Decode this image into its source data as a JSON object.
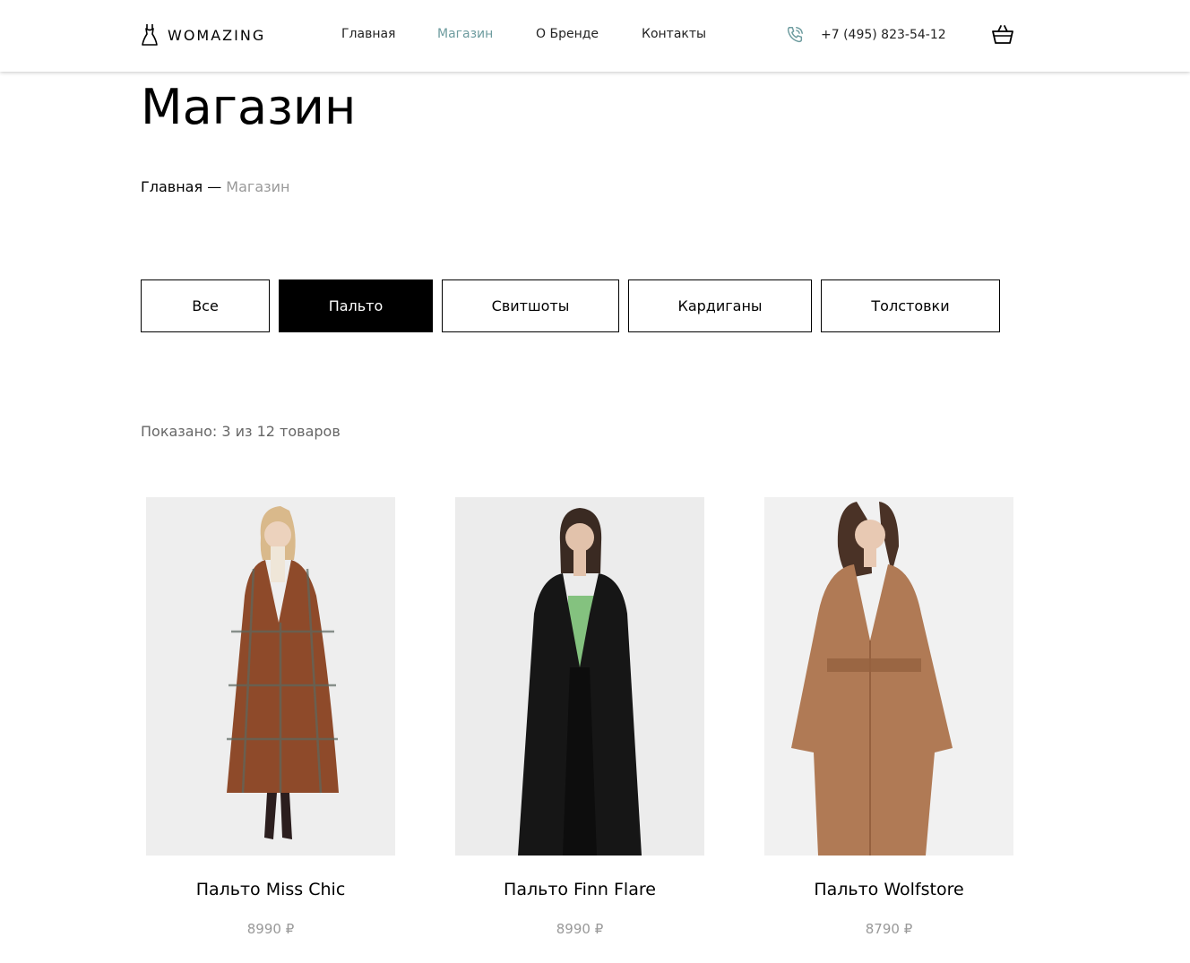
{
  "brand": {
    "name": "WOMAZING"
  },
  "nav": {
    "items": [
      {
        "label": "Главная",
        "active": false
      },
      {
        "label": "Магазин",
        "active": true
      },
      {
        "label": "О Бренде",
        "active": false
      },
      {
        "label": "Контакты",
        "active": false
      }
    ],
    "accent_color": "#6e9c9f"
  },
  "header": {
    "phone": "+7 (495) 823-54-12"
  },
  "page": {
    "title": "Магазин",
    "breadcrumb": {
      "home": "Главная",
      "separator": "—",
      "current": "Магазин"
    }
  },
  "filters": [
    {
      "label": "Все",
      "active": false
    },
    {
      "label": "Пальто",
      "active": true
    },
    {
      "label": "Свитшоты",
      "active": false
    },
    {
      "label": "Кардиганы",
      "active": false
    },
    {
      "label": "Толстовки",
      "active": false
    }
  ],
  "shown_text": "Показано: 3 из 12 товаров",
  "products": [
    {
      "name": "Пальто Miss Chic",
      "price": "8990 ₽",
      "coat_color": "#8e4a2a"
    },
    {
      "name": "Пальто Finn Flare",
      "price": "8990 ₽",
      "coat_color": "#161616"
    },
    {
      "name": "Пальто Wolfstore",
      "price": "8790 ₽",
      "coat_color": "#b07a55"
    }
  ]
}
